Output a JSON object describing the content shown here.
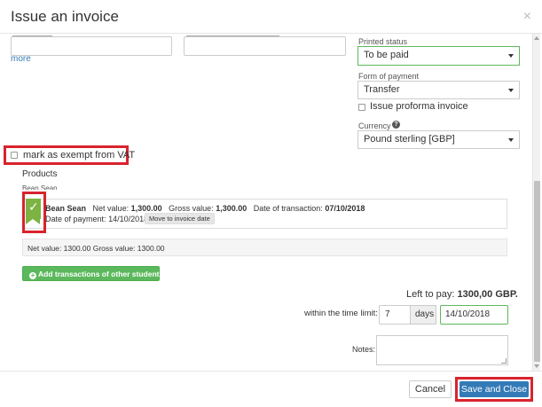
{
  "dialog": {
    "title": "Issue an invoice",
    "close_glyph": "×"
  },
  "top_form": {
    "more_link": "more"
  },
  "printed_status": {
    "label": "Printed status",
    "value": "To be paid"
  },
  "form_of_payment": {
    "label": "Form of payment",
    "value": "Transfer"
  },
  "proforma": {
    "label": "Issue proforma invoice"
  },
  "currency": {
    "label": "Currency",
    "help_glyph": "?",
    "value": "Pound sterling [GBP]"
  },
  "vat_exempt": {
    "label": "mark as exempt from VAT"
  },
  "products": {
    "title": "Products",
    "student_group": "Bean Sean",
    "item": {
      "name": "Bean Sean",
      "net_label": "Net value:",
      "net_value": "1,300.00",
      "gross_label": "Gross value:",
      "gross_value": "1,300.00",
      "transaction_label": "Date of transaction:",
      "transaction_date": "07/10/2018",
      "payment_label": "Date of payment:",
      "payment_date": "14/10/2018",
      "move_button": "Move to invoice date"
    },
    "summary": "Net value: 1300.00 Gross value: 1300.00",
    "add_button": "Add transactions of other students"
  },
  "payment": {
    "left_label": "Left to pay:",
    "left_value": "1300,00 GBP.",
    "time_limit_label": "within the time limit:",
    "days_value": "7",
    "days_unit": "days",
    "due_date": "14/10/2018",
    "notes_label": "Notes:"
  },
  "footer": {
    "cancel_label": "Cancel",
    "save_label": "Save and Close"
  },
  "colors": {
    "accent": "#337ab7",
    "success": "#5cb85c",
    "highlight": "#d9232d"
  }
}
